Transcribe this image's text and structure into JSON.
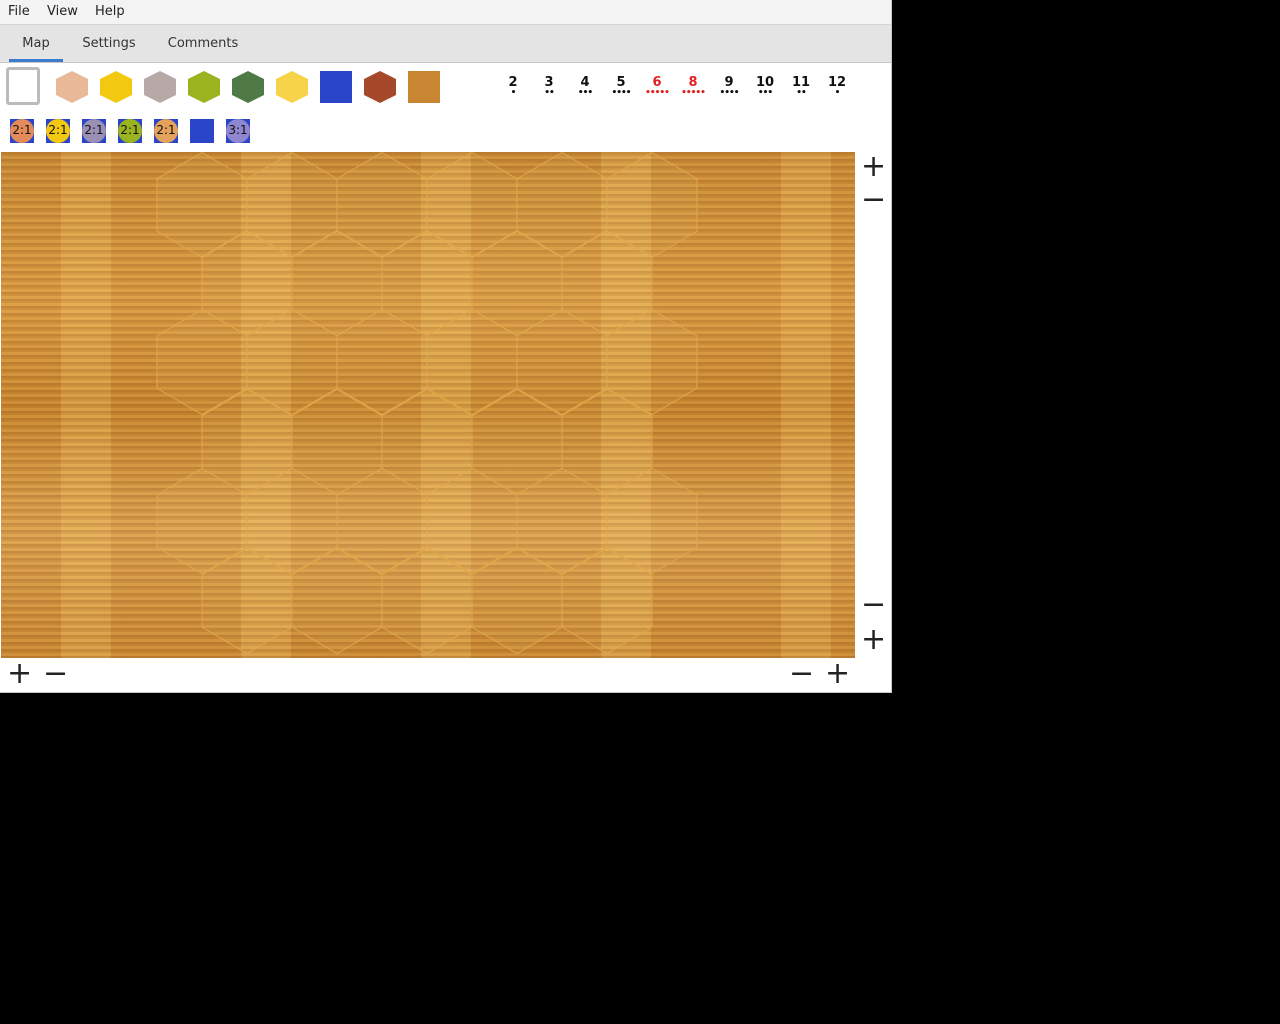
{
  "menu": {
    "file": "File",
    "view": "View",
    "help": "Help"
  },
  "tabs": {
    "map": "Map",
    "settings": "Settings",
    "comments": "Comments",
    "active": "Map"
  },
  "tiles": [
    {
      "name": "empty-tile",
      "color": "#ffffff"
    },
    {
      "name": "clay-hex",
      "color": "#e9b99a"
    },
    {
      "name": "wheat-hex",
      "color": "#f2c811"
    },
    {
      "name": "ore-hex",
      "color": "#b8a9a9"
    },
    {
      "name": "sheep-hex",
      "color": "#9bb31f"
    },
    {
      "name": "forest-hex",
      "color": "#4f7a45"
    },
    {
      "name": "desert-hex",
      "color": "#f7d34a"
    },
    {
      "name": "water-tile",
      "color": "#2a45c8"
    },
    {
      "name": "gold-hex",
      "color": "#a6492a"
    },
    {
      "name": "wood-background-tile",
      "color": "#c88632"
    }
  ],
  "numbers": [
    {
      "label": "2",
      "dots": "•",
      "color": "#111111"
    },
    {
      "label": "3",
      "dots": "••",
      "color": "#111111"
    },
    {
      "label": "4",
      "dots": "•••",
      "color": "#111111"
    },
    {
      "label": "5",
      "dots": "••••",
      "color": "#111111"
    },
    {
      "label": "6",
      "dots": "•••••",
      "color": "#e02020"
    },
    {
      "label": "8",
      "dots": "•••••",
      "color": "#e02020"
    },
    {
      "label": "9",
      "dots": "••••",
      "color": "#111111"
    },
    {
      "label": "10",
      "dots": "•••",
      "color": "#111111"
    },
    {
      "label": "11",
      "dots": "••",
      "color": "#111111"
    },
    {
      "label": "12",
      "dots": "•",
      "color": "#111111"
    }
  ],
  "ports": [
    {
      "label": "2:1",
      "color": "#e58a5a"
    },
    {
      "label": "2:1",
      "color": "#f2c811"
    },
    {
      "label": "2:1",
      "color": "#9a8fb5"
    },
    {
      "label": "2:1",
      "color": "#9bb31f"
    },
    {
      "label": "2:1",
      "color": "#e5a25a"
    },
    {
      "label": "",
      "color": "#2a45c8"
    },
    {
      "label": "3:1",
      "color": "#8f86d0"
    }
  ],
  "zoom": {
    "plus": "+",
    "minus": "−"
  },
  "map": {
    "hex_line_color": "#e0a84a"
  }
}
